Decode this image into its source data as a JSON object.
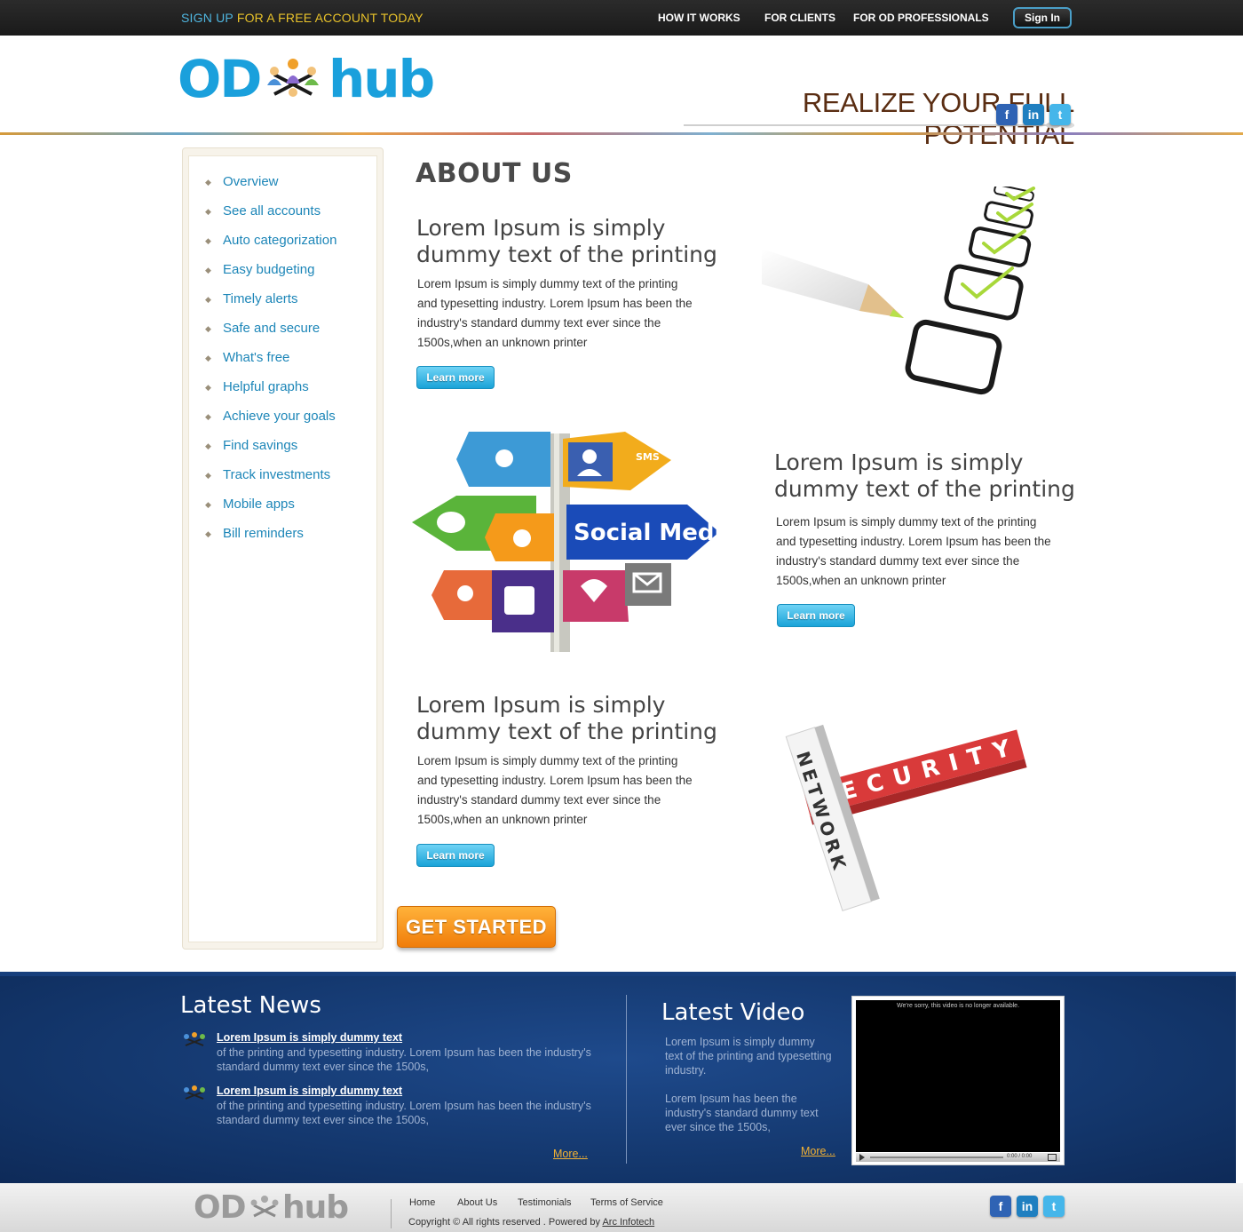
{
  "topbar": {
    "signup_part1": "SIGN UP",
    "signup_part2": "FOR A FREE ACCOUNT TODAY",
    "nav": [
      "HOW IT WORKS",
      "FOR CLIENTS",
      "FOR OD PROFESSIONALS"
    ],
    "signin_label": "Sign In"
  },
  "header": {
    "logo_left": "OD",
    "logo_right": "hub",
    "tagline": "REALIZE YOUR FULL POTENTIAL",
    "social_icons": [
      "facebook-icon",
      "linkedin-icon",
      "twitter-icon"
    ],
    "social_glyphs": [
      "f",
      "in",
      "t"
    ]
  },
  "sidebar": {
    "items": [
      "Overview",
      "See all accounts",
      "Auto categorization",
      "Easy budgeting",
      "Timely alerts",
      "Safe and secure",
      "What's free",
      "Helpful graphs",
      "Achieve your goals",
      "Find savings",
      "Track investments",
      "Mobile apps",
      "Bill reminders"
    ]
  },
  "main": {
    "title": "ABOUT US",
    "sections": [
      {
        "heading_line1": "Lorem Ipsum is simply",
        "heading_line2": "dummy text of the printing",
        "body_lines": [
          "Lorem Ipsum is simply dummy text of the printing",
          "and typesetting industry. Lorem Ipsum has been the",
          "industry's standard dummy text ever since the",
          "1500s,when an unknown printer"
        ],
        "button": "Learn more"
      },
      {
        "heading_line1": "Lorem Ipsum is simply",
        "heading_line2": "dummy text of the printing",
        "body_lines": [
          "Lorem Ipsum is simply dummy text of the printing",
          "and typesetting industry. Lorem Ipsum has been the",
          "industry's standard dummy text ever since the",
          "1500s,when an unknown printer"
        ],
        "button": "Learn more"
      },
      {
        "heading_line1": "Lorem Ipsum is simply",
        "heading_line2": "dummy text of the printing",
        "body_lines": [
          "Lorem Ipsum is simply dummy text of the printing",
          "and typesetting industry. Lorem Ipsum has been the",
          "industry's standard dummy text ever since the",
          "1500s,when an unknown printer"
        ],
        "button": "Learn more"
      }
    ],
    "images": {
      "social_sign_text": "Social Media",
      "sms_text": "SMS",
      "security_word": "SECURITY",
      "network_word": "NETWORK"
    },
    "get_started": "GET STARTED"
  },
  "news": {
    "title": "Latest News",
    "items": [
      {
        "link": "Lorem Ipsum is simply dummy text",
        "text_line1": "of the printing and typesetting industry. Lorem Ipsum has been the industry's",
        "text_line2": "standard dummy text ever since the 1500s,"
      },
      {
        "link": "Lorem Ipsum is simply dummy text",
        "text_line1": "of the printing and typesetting industry. Lorem Ipsum has been the industry's",
        "text_line2": "standard dummy text ever since the 1500s,"
      }
    ],
    "more": "More..."
  },
  "video": {
    "title": "Latest Video",
    "para1": [
      "Lorem Ipsum is simply dummy",
      "text of the printing and typesetting",
      "industry."
    ],
    "para2": [
      "Lorem Ipsum has been the",
      "industry's standard dummy text",
      "ever since the 1500s,"
    ],
    "more": "More...",
    "player_message": "We're sorry, this video is no longer available.",
    "player_time": "0:00 / 0:00"
  },
  "footer": {
    "logo_left": "OD",
    "logo_right": "hub",
    "links": [
      "Home",
      "About Us",
      "Testimonials",
      "Terms of Service"
    ],
    "copyright_text": "Copyright ©   All rights reserved . Powered by",
    "powered_by": "Arc Infotech",
    "social_icons": [
      "facebook-icon",
      "linkedin-icon",
      "twitter-icon"
    ],
    "social_glyphs": [
      "f",
      "in",
      "t"
    ]
  },
  "colors": {
    "accent_blue": "#1aa0dc",
    "signup_yellow": "#e8c22a",
    "tagline_brown": "#5a2d12",
    "band_blue": "#123468",
    "cta_orange": "#f07d0a",
    "more_link": "#f3b233"
  }
}
